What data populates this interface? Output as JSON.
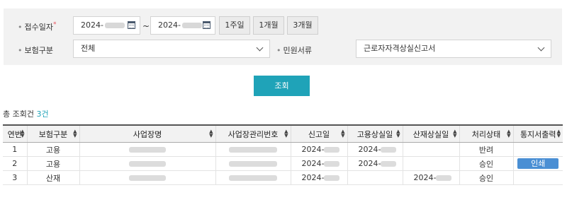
{
  "filter": {
    "receipt_date_label": "접수일자",
    "required_mark": "*",
    "date_from": "2024-",
    "date_separator": "~",
    "date_to": "2024-",
    "period_buttons": [
      "1주일",
      "1개월",
      "3개월"
    ],
    "insurance_type_label": "보험구분",
    "insurance_type_value": "전체",
    "document_label": "민원서류",
    "document_value": "근로자자격상실신고서"
  },
  "search_button": "조회",
  "total": {
    "prefix": "총 조회건",
    "count": "3건"
  },
  "table": {
    "headers": [
      "연번",
      "보험구분",
      "사업장명",
      "사업장관리번호",
      "신고일",
      "고용상실일",
      "산재상실일",
      "처리상태",
      "통지서출력"
    ],
    "rows": [
      {
        "no": "1",
        "type": "고용",
        "report_date": "2024-",
        "emp_loss_date": "2024-",
        "ind_loss_date": "",
        "status": "반려",
        "print": ""
      },
      {
        "no": "2",
        "type": "고용",
        "report_date": "2024-",
        "emp_loss_date": "2024-",
        "ind_loss_date": "",
        "status": "승인",
        "print": "인쇄"
      },
      {
        "no": "3",
        "type": "산재",
        "report_date": "2024-",
        "emp_loss_date": "",
        "ind_loss_date": "2024-",
        "status": "승인",
        "print": ""
      }
    ]
  },
  "colors": {
    "accent": "#1fa3b8",
    "print_button": "#4a8fd4",
    "required": "#e8515d"
  },
  "icons": [
    "calendar-icon",
    "chevron-down-icon",
    "sort-icon"
  ]
}
